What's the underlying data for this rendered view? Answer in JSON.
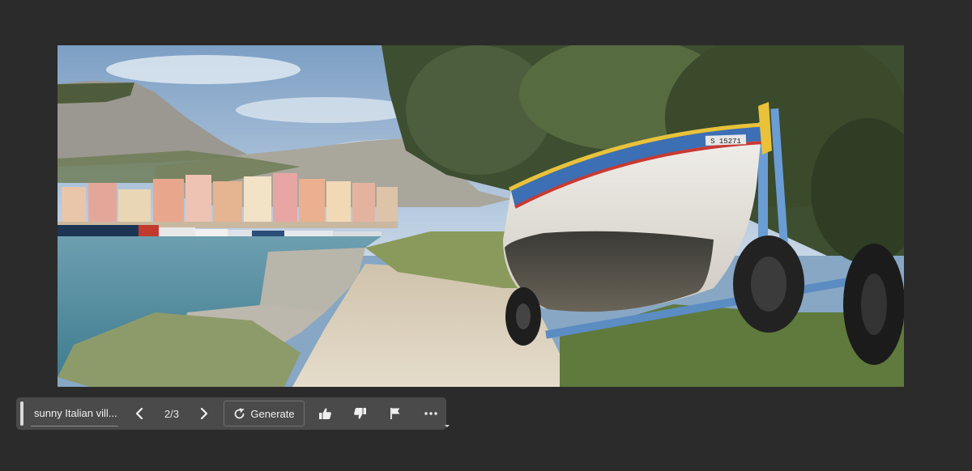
{
  "toolbar": {
    "prompt_text": "sunny Italian vill...",
    "page_indicator": "2/3",
    "generate_label": "Generate"
  },
  "icons": {
    "prev": "chevron-left-icon",
    "next": "chevron-right-icon",
    "generate": "generate-refresh-icon",
    "like": "thumbs-up-icon",
    "dislike": "thumbs-down-icon",
    "report": "flag-icon",
    "more": "more-horizontal-icon"
  },
  "image": {
    "boat_registration": "S 15271"
  },
  "colors": {
    "background": "#2b2b2b",
    "toolbar": "#4a4a4a"
  }
}
